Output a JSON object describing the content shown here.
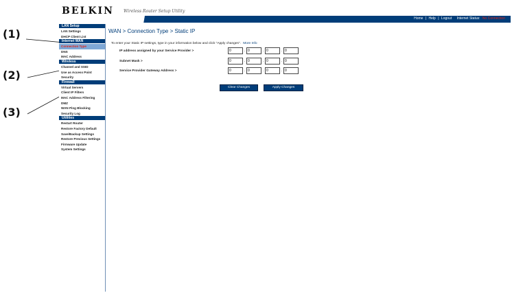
{
  "callouts": [
    "(1)",
    "(2)",
    "(3)"
  ],
  "header": {
    "logo": "BELKIN",
    "subtitle": "Wireless Router Setup Utility",
    "links": {
      "home": "Home",
      "sep1": "|",
      "help": "Help",
      "sep2": "|",
      "logout": "Logout"
    },
    "status_label": "Internet Status:",
    "status_value": "No Connection"
  },
  "sidebar": {
    "sections": [
      {
        "title": "LAN Setup",
        "items": [
          "LAN Settings",
          "DHCP Client List"
        ]
      },
      {
        "title": "Internet WAN",
        "items": [
          "Connection Type",
          "DNS",
          "MAC Address"
        ]
      },
      {
        "title": "Wireless",
        "items": [
          "Channel and SSID",
          "Use as Access Point",
          "Security"
        ]
      },
      {
        "title": "Firewall",
        "items": [
          "Virtual Servers",
          "Client IP Filters",
          "MAC Address Filtering",
          "DMZ",
          "WAN Ping Blocking",
          "Security Log"
        ]
      },
      {
        "title": "Utilities",
        "items": [
          "Restart Router",
          "Restore Factory Default",
          "Save/Backup Settings",
          "Restore Previous Settings",
          "Firmware Update",
          "System Settings"
        ]
      }
    ],
    "active_item": "Connection Type"
  },
  "main": {
    "title": "WAN > Connection Type > Static IP",
    "intro": "To enter your Static IP settings, type in your information below and click \"Apply changes\".",
    "help_link": "More Info",
    "fields": [
      {
        "label": "IP address assigned by your Service Provider >",
        "values": [
          "0",
          "0",
          "0",
          "0"
        ]
      },
      {
        "label": "Subnet Mask >",
        "values": [
          "0",
          "0",
          "0",
          "0"
        ]
      },
      {
        "label": "Service Provider Gateway Address >",
        "values": [
          "0",
          "0",
          "0",
          "0"
        ]
      }
    ],
    "separator": ".",
    "clear_button": "Clear Changes",
    "apply_button": "Apply Changes"
  }
}
